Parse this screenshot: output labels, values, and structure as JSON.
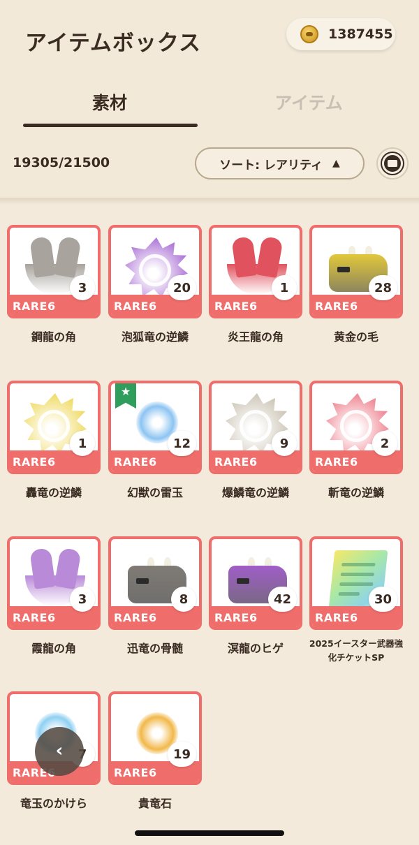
{
  "header": {
    "title": "アイテムボックス",
    "currency": {
      "icon": "gold-coin-icon",
      "value": "1387455"
    }
  },
  "tabs": [
    {
      "label": "素材",
      "active": true
    },
    {
      "label": "アイテム",
      "active": false
    }
  ],
  "toolbar": {
    "capacity": "19305/21500",
    "sort_label": "ソート: レアリティ",
    "sort_arrow": "▲",
    "filter_icon": "monster-filter-icon"
  },
  "items": [
    {
      "name": "鋼龍の角",
      "rarity": "RARE6",
      "count": "3",
      "icon": "horn-icon",
      "color": "#a8a39c"
    },
    {
      "name": "泡狐竜の逆鱗",
      "rarity": "RARE6",
      "count": "20",
      "icon": "scale-icon",
      "color": "#b07ad8"
    },
    {
      "name": "炎王龍の角",
      "rarity": "RARE6",
      "count": "1",
      "icon": "horn-icon",
      "color": "#e0525e"
    },
    {
      "name": "黄金の毛",
      "rarity": "RARE6",
      "count": "28",
      "icon": "beast-icon",
      "color": "#e2c83a"
    },
    {
      "name": "轟竜の逆鱗",
      "rarity": "RARE6",
      "count": "1",
      "icon": "scale-icon",
      "color": "#f0dc6a"
    },
    {
      "name": "幻獣の雷玉",
      "rarity": "RARE6",
      "count": "12",
      "icon": "orb-icon",
      "color": "#8cc4f2",
      "favorite": true
    },
    {
      "name": "爆鱗竜の逆鱗",
      "rarity": "RARE6",
      "count": "9",
      "icon": "scale-icon",
      "color": "#cfc8ba"
    },
    {
      "name": "斬竜の逆鱗",
      "rarity": "RARE6",
      "count": "2",
      "icon": "scale-icon",
      "color": "#ef8a96"
    },
    {
      "name": "霞龍の角",
      "rarity": "RARE6",
      "count": "3",
      "icon": "horn-icon",
      "color": "#b98ad8"
    },
    {
      "name": "迅竜の骨髄",
      "rarity": "RARE6",
      "count": "8",
      "icon": "beast-icon",
      "color": "#7f7a74"
    },
    {
      "name": "溟龍のヒゲ",
      "rarity": "RARE6",
      "count": "42",
      "icon": "beast-icon",
      "color": "#a05ec8"
    },
    {
      "name": "2025イースター武器強化チケットSP",
      "rarity": "RARE6",
      "count": "30",
      "icon": "ticket-icon",
      "color": "#a8e8a6"
    },
    {
      "name": "竜玉のかけら",
      "rarity": "RARE6",
      "count": "7",
      "icon": "orb-icon",
      "color": "#8fd0f2"
    },
    {
      "name": "貴竜石",
      "rarity": "RARE6",
      "count": "19",
      "icon": "orb-icon",
      "color": "#f2b84a"
    }
  ],
  "back_button": {
    "icon": "chevron-left-icon",
    "glyph": "‹"
  },
  "colors": {
    "card_border": "#ef6d6b",
    "background": "#f3eadb",
    "text": "#3a2b22"
  }
}
